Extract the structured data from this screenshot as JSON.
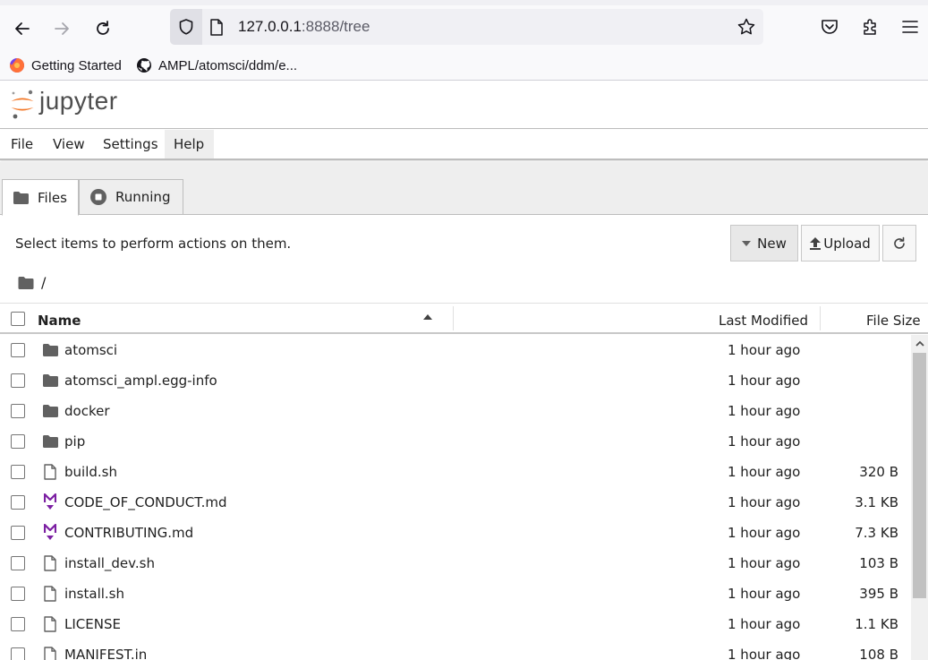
{
  "browser": {
    "url_host": "127.0.0.1",
    "url_rest": ":8888/tree",
    "bookmarks": [
      {
        "label": "Getting Started",
        "icon": "firefox-icon"
      },
      {
        "label": "AMPL/atomsci/ddm/e...",
        "icon": "github-icon"
      }
    ]
  },
  "jupyter": {
    "wordmark": "jupyter",
    "menu": [
      "File",
      "View",
      "Settings",
      "Help"
    ],
    "tabs": [
      {
        "label": "Files",
        "icon": "folder-icon"
      },
      {
        "label": "Running",
        "icon": "stop-circle-icon"
      }
    ]
  },
  "files_panel": {
    "toolbar_text": "Select items to perform actions on them.",
    "new_label": "New",
    "upload_label": "Upload",
    "breadcrumb": "/",
    "columns": {
      "name": "Name",
      "modified": "Last Modified",
      "size": "File Size"
    },
    "items": [
      {
        "name": "atomsci",
        "type": "folder",
        "modified": "1 hour ago",
        "size": ""
      },
      {
        "name": "atomsci_ampl.egg-info",
        "type": "folder",
        "modified": "1 hour ago",
        "size": ""
      },
      {
        "name": "docker",
        "type": "folder",
        "modified": "1 hour ago",
        "size": ""
      },
      {
        "name": "pip",
        "type": "folder",
        "modified": "1 hour ago",
        "size": ""
      },
      {
        "name": "build.sh",
        "type": "file",
        "modified": "1 hour ago",
        "size": "320 B"
      },
      {
        "name": "CODE_OF_CONDUCT.md",
        "type": "markdown",
        "modified": "1 hour ago",
        "size": "3.1 KB"
      },
      {
        "name": "CONTRIBUTING.md",
        "type": "markdown",
        "modified": "1 hour ago",
        "size": "7.3 KB"
      },
      {
        "name": "install_dev.sh",
        "type": "file",
        "modified": "1 hour ago",
        "size": "103 B"
      },
      {
        "name": "install.sh",
        "type": "file",
        "modified": "1 hour ago",
        "size": "395 B"
      },
      {
        "name": "LICENSE",
        "type": "file",
        "modified": "1 hour ago",
        "size": "1.1 KB"
      },
      {
        "name": "MANIFEST.in",
        "type": "file",
        "modified": "1 hour ago",
        "size": "108 B"
      }
    ]
  },
  "colors": {
    "jupyter_orange": "#f37726",
    "markdown_purple": "#7b1fa2",
    "icon_gray": "#616161"
  }
}
